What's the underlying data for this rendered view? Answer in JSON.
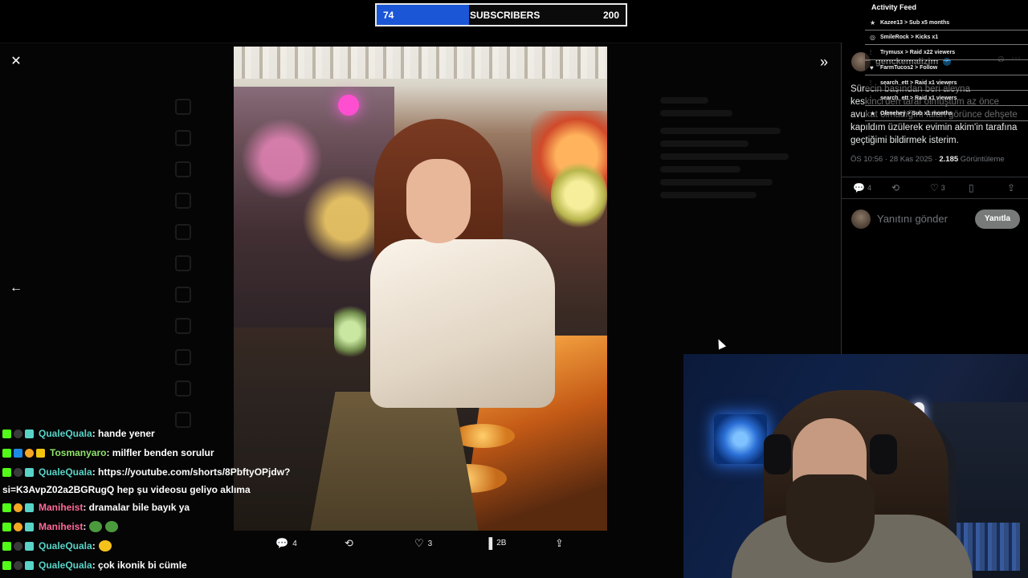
{
  "subscriber_goal": {
    "current": "74",
    "label": "SUBSCRIBERS",
    "goal": "200",
    "progress_fraction": 0.37
  },
  "activity_feed": {
    "title": "Activity Feed",
    "items": [
      {
        "icon": "star-icon",
        "text": "Kazee13 > Sub x5 months"
      },
      {
        "icon": "kick-icon",
        "text": "SmileRock > Kicks x1"
      },
      {
        "icon": "raid-icon",
        "text": "Trymusx > Raid x22 viewers"
      },
      {
        "icon": "heart-icon",
        "text": "FarmTucos2 > Follow"
      },
      {
        "icon": "raid-icon",
        "text": "search_ett > Raid x1 viewers"
      },
      {
        "icon": "raid-icon",
        "text": "search_ett > Raid x1 viewers"
      },
      {
        "icon": "star-icon",
        "text": "Olenehey > Sub x1 months"
      }
    ]
  },
  "tweet": {
    "author": "genckemalizim",
    "text": "Sürecin başından beri aleyna keskinci'den taraf olmuştum az önce avukat olmadığını falan görünce dehşete kapıldım üzülerek evimin akim'in tarafına geçtiğimi bildirmek isterim.",
    "time": "ÖS 10:56 · 28 Kas 2025 · ",
    "views_count": "2.185",
    "views_label": " Görüntüleme",
    "replies": "4",
    "retweets": "",
    "likes": "3",
    "reply_placeholder": "Yanıtını gönder",
    "reply_button": "Yanıtla"
  },
  "photo_actions": {
    "replies": "4",
    "likes": "3",
    "views": "2B"
  },
  "chat": [
    {
      "user": "QualeQuala",
      "user_color": "#59d3c7",
      "msg": " : hande yener"
    },
    {
      "user": "Tosmanyaro",
      "user_color": "#8ee36b",
      "msg": " : milfler benden sorulur"
    },
    {
      "user": "QualeQuala",
      "user_color": "#59d3c7",
      "msg": " : https://youtube.com/shorts/8PbftyOPjdw?"
    },
    {
      "user": "",
      "user_color": "#fff",
      "msg": "si=K3AvpZ02a2BGRugQ hep şu videosu geliyo aklıma"
    },
    {
      "user": "Maniheist",
      "user_color": "#ff6b9a",
      "msg": " : dramalar bile bayık ya"
    },
    {
      "user": "Maniheist",
      "user_color": "#ff6b9a",
      "msg": " : "
    },
    {
      "user": "QualeQuala",
      "user_color": "#59d3c7",
      "msg": " : "
    },
    {
      "user": "QualeQuala",
      "user_color": "#59d3c7",
      "msg": " : çok ikonik bi cümle"
    }
  ],
  "icons": {
    "close": "close-icon",
    "expand": "double-chevron-right-icon",
    "back": "arrow-left-icon",
    "reply": "speech-bubble-icon",
    "retweet": "retweet-icon",
    "like": "heart-icon",
    "views": "bar-chart-icon",
    "share": "share-icon",
    "bookmark": "bookmark-icon"
  },
  "colors": {
    "accent_blue": "#1a56d6",
    "verified": "#1d9bf0",
    "kick_green": "#53fc18"
  }
}
